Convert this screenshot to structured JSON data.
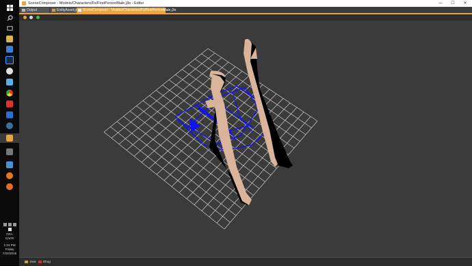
{
  "window": {
    "title": "SceneComposer - Models/Characters/Fx/FirstPersonMale.j3o - Editor",
    "minimize_glyph": "—",
    "maximize_glyph": "☐",
    "close_glyph": "✕"
  },
  "tabs": [
    {
      "label": "Output",
      "active": false,
      "icon": "output-icon"
    },
    {
      "label": "EntityAsset.java",
      "active": false,
      "icon": "java-file-icon"
    },
    {
      "label": "SceneComposer - Models/Characters/Fx/FirstPersonMale.j3o",
      "active": true,
      "icon": "scene-icon"
    }
  ],
  "toolbar": {
    "tools": [
      "camera-icon",
      "eye-icon",
      "move-icon"
    ]
  },
  "taskbar": {
    "icons": [
      "start-icon",
      "search-icon",
      "task-view-icon",
      "file-explorer-icon",
      "settings-icon",
      "photoshop-icon",
      "music-icon",
      "cube-icon",
      "chrome-icon",
      "app-icon",
      "windows-icon",
      "steam-icon",
      "editor-icon",
      "calculator-icon",
      "gallery-icon",
      "blender-icon",
      "firefox-icon"
    ],
    "tray": {
      "lang_primary": "FRA",
      "lang_secondary": "CAFR",
      "time": "1:24 PM",
      "day": "Friday",
      "date": "7/22/2016"
    }
  },
  "statusbar": {
    "items": [
      {
        "label": "Java",
        "icon": "java-icon"
      },
      {
        "label": "Dbug",
        "icon": "debug-icon"
      }
    ]
  },
  "colors": {
    "accent": "#e9a440",
    "viewport_bg": "#3b3b3b",
    "grid": "#cfcfcf",
    "skeleton": "#1010ff",
    "skin": "#d9b49a"
  }
}
